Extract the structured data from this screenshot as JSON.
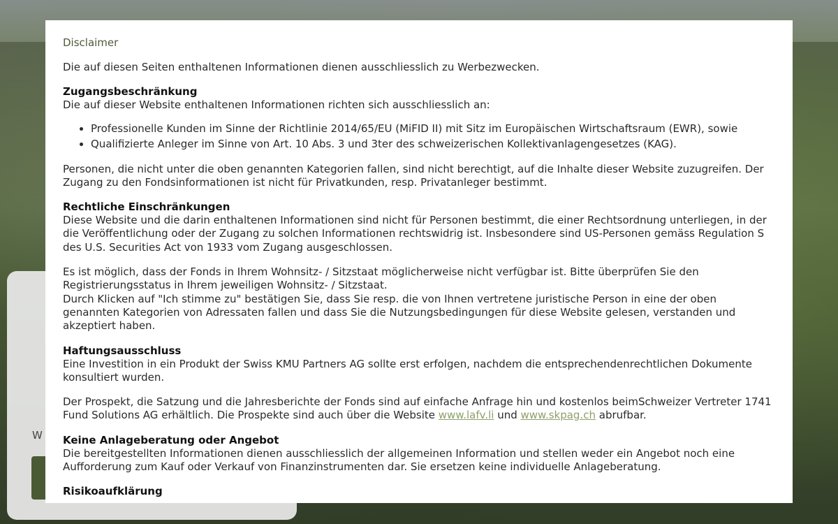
{
  "background_card": {
    "text_fragment": "W"
  },
  "modal": {
    "title": "Disclaimer",
    "intro": "Die auf diesen Seiten enthaltenen Informationen dienen ausschliesslich zu Werbezwecken.",
    "access": {
      "heading": "Zugangsbeschränkung",
      "lead": "Die auf dieser Website enthaltenen Informationen richten sich ausschliesslich an:",
      "items": [
        "Professionelle Kunden im Sinne der Richtlinie 2014/65/EU (MiFID II) mit Sitz im Europäischen Wirtschaftsraum (EWR), sowie",
        "Qualifizierte Anleger im Sinne von Art. 10 Abs. 3 und 3ter des schweizerischen Kollektivanlagengesetzes (KAG)."
      ],
      "note": "Personen, die nicht unter die oben genannten Kategorien fallen, sind nicht berechtigt, auf die Inhalte dieser Website zuzugreifen. Der Zugang zu den Fondsinformationen ist nicht für Privatkunden, resp. Privatanleger bestimmt."
    },
    "legal": {
      "heading": "Rechtliche Einschränkungen",
      "p1": "Diese Website und die darin enthaltenen Informationen sind nicht für Personen bestimmt, die einer Rechtsordnung unterliegen, in der die Veröffentlichung oder der Zugang zu solchen Informationen rechtswidrig ist. Insbesondere sind US-Personen gemäss Regulation S des U.S. Securities Act von 1933 vom Zugang ausgeschlossen.",
      "p2": "Es ist möglich, dass der Fonds in Ihrem Wohnsitz- / Sitzstaat möglicherweise nicht verfügbar ist. Bitte überprüfen Sie den Registrierungsstatus in Ihrem jeweiligen Wohnsitz- / Sitzstaat.",
      "p3": "Durch Klicken auf \"Ich stimme zu\" bestätigen Sie, dass Sie resp. die von Ihnen vertretene juristische Person in eine der oben genannten Kategorien von Adressaten fallen und dass Sie die Nutzungsbedingungen für diese Website gelesen, verstanden und akzeptiert haben."
    },
    "liability": {
      "heading": "Haftungsausschluss",
      "p1": "Eine Investition in ein Produkt der Swiss KMU Partners AG sollte erst erfolgen, nachdem die entsprechendenrechtlichen Dokumente konsultiert wurden.",
      "p2_before": "Der Prospekt, die Satzung und die Jahresberichte der Fonds sind auf einfache Anfrage hin und kostenlos beimSchweizer Vertreter 1741 Fund Solutions AG erhältlich. Die Prospekte sind auch über die Website ",
      "link1": "www.lafv.li",
      "p2_middle": " und ",
      "link2": "www.skpag.ch",
      "p2_after": " abrufbar."
    },
    "advice": {
      "heading": "Keine Anlageberatung oder Angebot",
      "p1": "Die bereitgestellten Informationen dienen ausschliesslich der allgemeinen Information und stellen weder ein Angebot noch eine Aufforderung zum Kauf oder Verkauf von Finanzinstrumenten dar. Sie ersetzen keine individuelle Anlageberatung."
    },
    "risk": {
      "heading": "Risikoaufklärung"
    }
  }
}
